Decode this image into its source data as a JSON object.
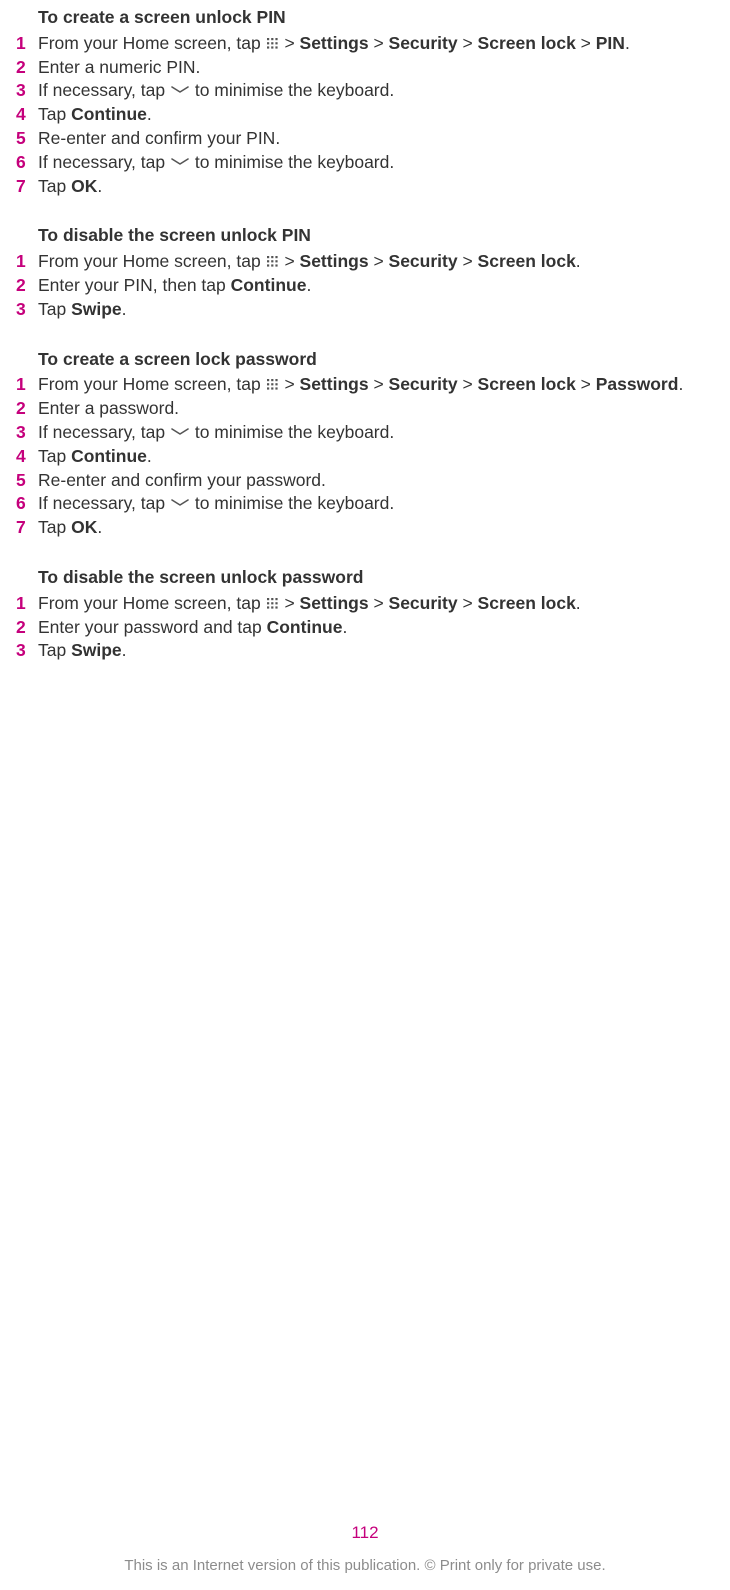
{
  "sections": [
    {
      "title": "To create a screen unlock PIN",
      "steps": [
        {
          "parts": [
            {
              "t": "From your Home screen, tap "
            },
            {
              "icon": "apps"
            },
            {
              "t": " > "
            },
            {
              "b": "Settings"
            },
            {
              "t": " > "
            },
            {
              "b": "Security"
            },
            {
              "t": " > "
            },
            {
              "b": "Screen lock"
            },
            {
              "t": " > "
            },
            {
              "b": "PIN"
            },
            {
              "t": "."
            }
          ]
        },
        {
          "parts": [
            {
              "t": "Enter a numeric PIN."
            }
          ]
        },
        {
          "parts": [
            {
              "t": "If necessary, tap "
            },
            {
              "icon": "chevron"
            },
            {
              "t": " to minimise the keyboard."
            }
          ]
        },
        {
          "parts": [
            {
              "t": "Tap "
            },
            {
              "b": "Continue"
            },
            {
              "t": "."
            }
          ]
        },
        {
          "parts": [
            {
              "t": "Re-enter and confirm your PIN."
            }
          ]
        },
        {
          "parts": [
            {
              "t": "If necessary, tap "
            },
            {
              "icon": "chevron"
            },
            {
              "t": " to minimise the keyboard."
            }
          ]
        },
        {
          "parts": [
            {
              "t": "Tap "
            },
            {
              "b": "OK"
            },
            {
              "t": "."
            }
          ]
        }
      ]
    },
    {
      "title": "To disable the screen unlock PIN",
      "steps": [
        {
          "parts": [
            {
              "t": "From your Home screen, tap "
            },
            {
              "icon": "apps"
            },
            {
              "t": " > "
            },
            {
              "b": "Settings"
            },
            {
              "t": " > "
            },
            {
              "b": "Security"
            },
            {
              "t": " > "
            },
            {
              "b": "Screen lock"
            },
            {
              "t": "."
            }
          ]
        },
        {
          "parts": [
            {
              "t": "Enter your PIN, then tap "
            },
            {
              "b": "Continue"
            },
            {
              "t": "."
            }
          ]
        },
        {
          "parts": [
            {
              "t": "Tap "
            },
            {
              "b": "Swipe"
            },
            {
              "t": "."
            }
          ]
        }
      ]
    },
    {
      "title": "To create a screen lock password",
      "steps": [
        {
          "parts": [
            {
              "t": "From your Home screen, tap "
            },
            {
              "icon": "apps"
            },
            {
              "t": " > "
            },
            {
              "b": "Settings"
            },
            {
              "t": " > "
            },
            {
              "b": "Security"
            },
            {
              "t": " > "
            },
            {
              "b": "Screen lock"
            },
            {
              "t": " > "
            },
            {
              "b": "Password"
            },
            {
              "t": "."
            }
          ]
        },
        {
          "parts": [
            {
              "t": "Enter a password."
            }
          ]
        },
        {
          "parts": [
            {
              "t": "If necessary, tap "
            },
            {
              "icon": "chevron"
            },
            {
              "t": " to minimise the keyboard."
            }
          ]
        },
        {
          "parts": [
            {
              "t": "Tap "
            },
            {
              "b": "Continue"
            },
            {
              "t": "."
            }
          ]
        },
        {
          "parts": [
            {
              "t": "Re-enter and confirm your password."
            }
          ]
        },
        {
          "parts": [
            {
              "t": "If necessary, tap "
            },
            {
              "icon": "chevron"
            },
            {
              "t": " to minimise the keyboard."
            }
          ]
        },
        {
          "parts": [
            {
              "t": "Tap "
            },
            {
              "b": "OK"
            },
            {
              "t": "."
            }
          ]
        }
      ]
    },
    {
      "title": "To disable the screen unlock password",
      "steps": [
        {
          "parts": [
            {
              "t": "From your Home screen, tap "
            },
            {
              "icon": "apps"
            },
            {
              "t": " > "
            },
            {
              "b": "Settings"
            },
            {
              "t": " > "
            },
            {
              "b": "Security"
            },
            {
              "t": " > "
            },
            {
              "b": "Screen lock"
            },
            {
              "t": "."
            }
          ]
        },
        {
          "parts": [
            {
              "t": "Enter your password and tap "
            },
            {
              "b": "Continue"
            },
            {
              "t": "."
            }
          ]
        },
        {
          "parts": [
            {
              "t": "Tap "
            },
            {
              "b": "Swipe"
            },
            {
              "t": "."
            }
          ]
        }
      ]
    }
  ],
  "page_number": "112",
  "footer": "This is an Internet version of this publication. © Print only for private use."
}
